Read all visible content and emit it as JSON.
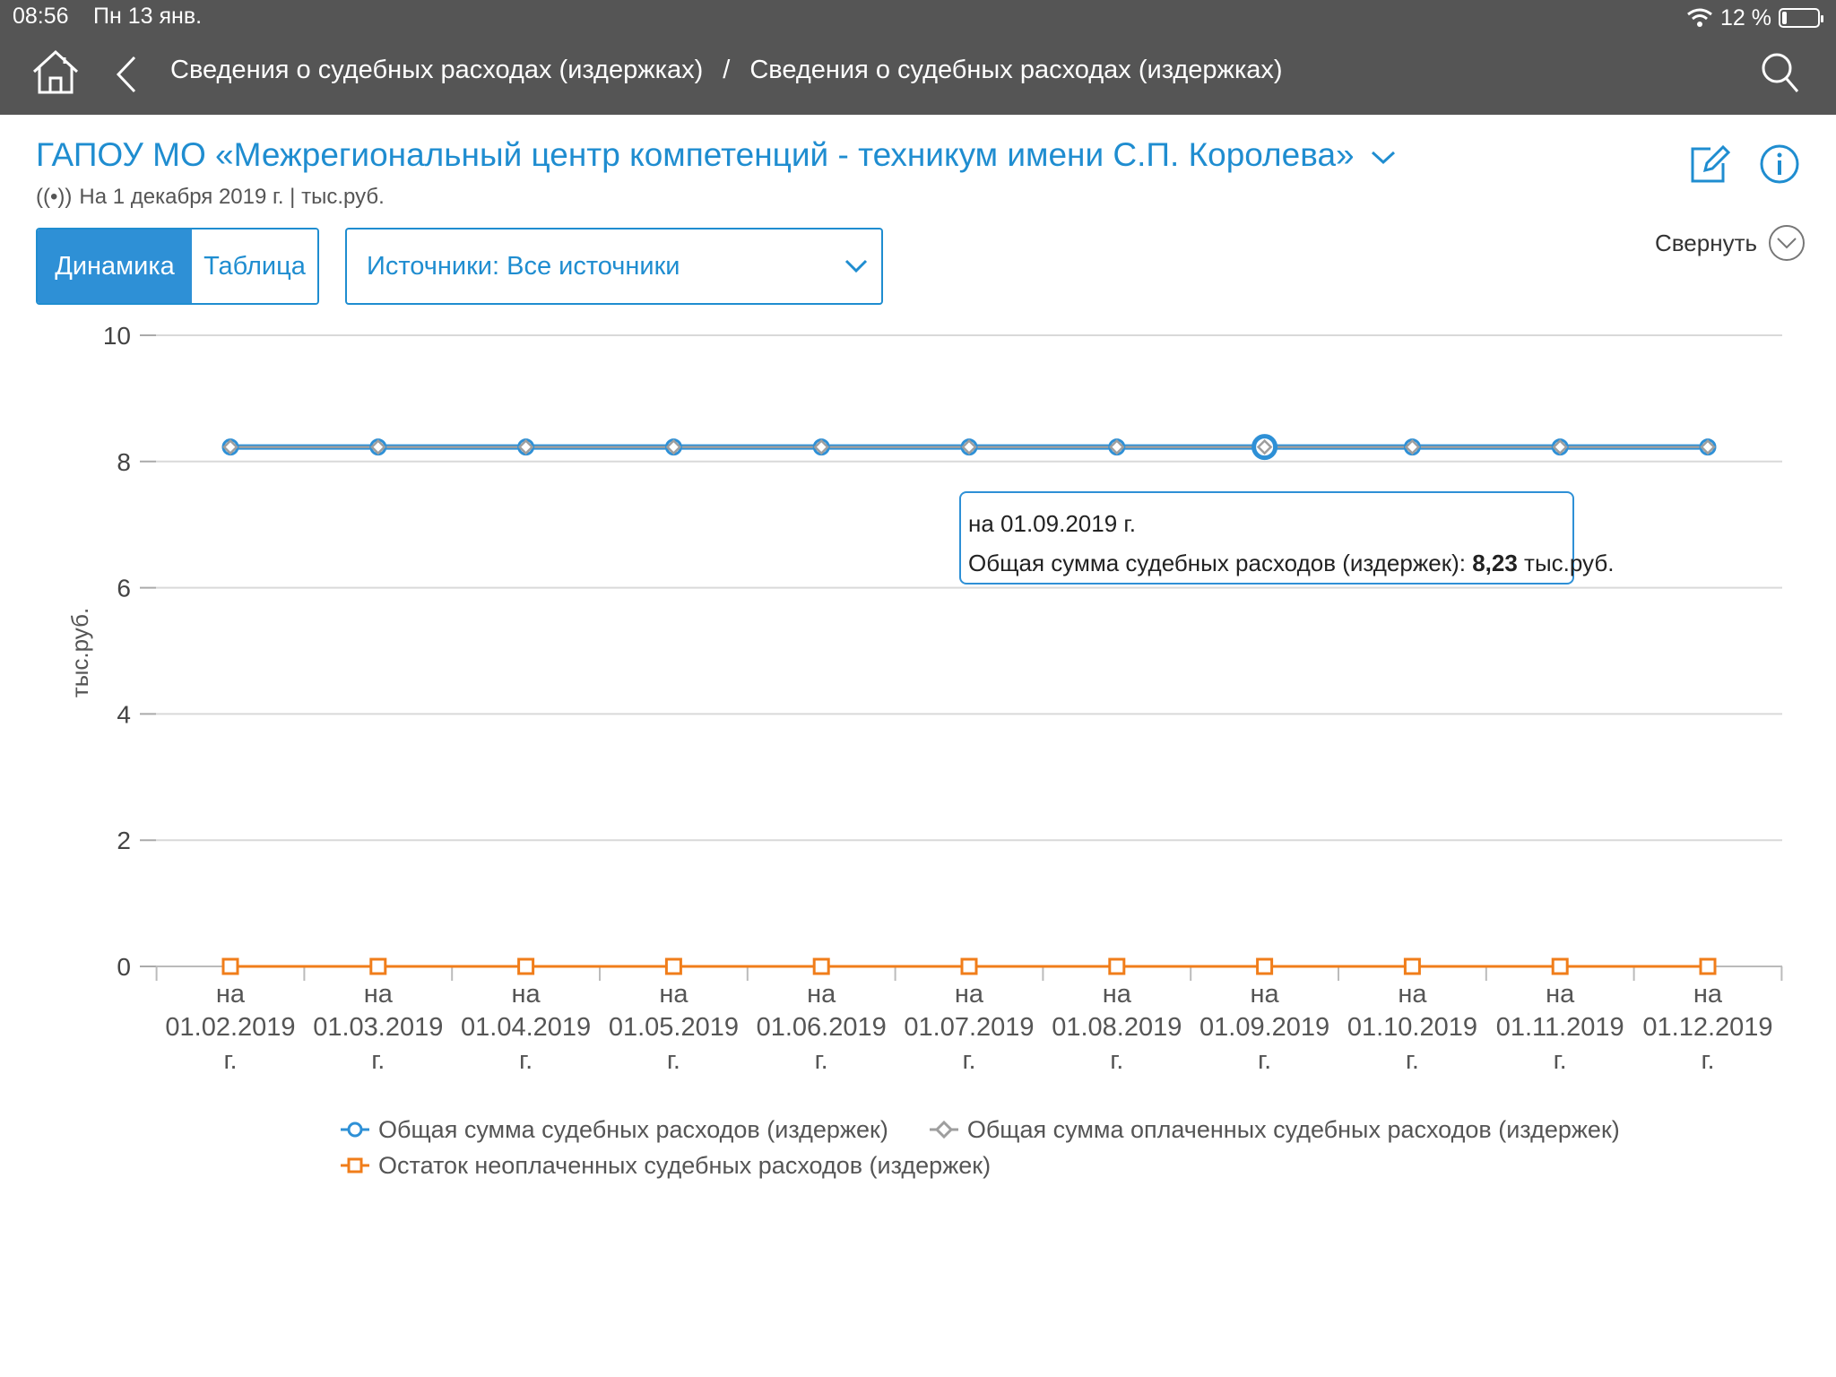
{
  "status_bar": {
    "time": "08:56",
    "date": "Пн 13 янв.",
    "battery": "12 %",
    "battery_level": 0.12
  },
  "nav": {
    "breadcrumb": [
      "Сведения о судебных расходах (издержках)",
      "Сведения о судебных расходах (издержках)"
    ],
    "separator": "/"
  },
  "header": {
    "org_title": "ГАПОУ МО «Межрегиональный центр компетенций - техникум имени С.П. Королева»",
    "live_icon": "((•))",
    "subtitle": "На 1 декабря 2019 г. | тыс.руб."
  },
  "controls": {
    "tab_dynamics": "Динамика",
    "tab_table": "Таблица",
    "active_tab": "dynamics",
    "sources_label": "Источники: Все источники",
    "collapse_label": "Свернуть"
  },
  "colors": {
    "accent": "#1f8dd0",
    "total_series": "#2e90d6",
    "paid_series": "#9e9e9e",
    "unpaid_series": "#f07d1a",
    "topbar": "#555555"
  },
  "tooltip": {
    "date_line": "на 01.09.2019 г.",
    "series_label": "Общая сумма судебных расходов (издержек):",
    "value": "8,23",
    "unit": "тыс.руб."
  },
  "chart_data": {
    "type": "line",
    "ylabel": "тыс.руб.",
    "xlabel": "",
    "ylim": [
      0,
      10
    ],
    "yticks": [
      0,
      2,
      4,
      6,
      8,
      10
    ],
    "grid": true,
    "legend_position": "bottom",
    "categories": [
      [
        "на",
        "01.02.2019",
        "г."
      ],
      [
        "на",
        "01.03.2019",
        "г."
      ],
      [
        "на",
        "01.04.2019",
        "г."
      ],
      [
        "на",
        "01.05.2019",
        "г."
      ],
      [
        "на",
        "01.06.2019",
        "г."
      ],
      [
        "на",
        "01.07.2019",
        "г."
      ],
      [
        "на",
        "01.08.2019",
        "г."
      ],
      [
        "на",
        "01.09.2019",
        "г."
      ],
      [
        "на",
        "01.10.2019",
        "г."
      ],
      [
        "на",
        "01.11.2019",
        "г."
      ],
      [
        "на",
        "01.12.2019",
        "г."
      ]
    ],
    "highlighted_index": 7,
    "series": [
      {
        "name": "Общая сумма судебных расходов (издержек)",
        "marker": "circle",
        "color": "#2e90d6",
        "values": [
          8.23,
          8.23,
          8.23,
          8.23,
          8.23,
          8.23,
          8.23,
          8.23,
          8.23,
          8.23,
          8.23
        ]
      },
      {
        "name": "Общая сумма оплаченных судебных расходов (издержек)",
        "marker": "diamond",
        "color": "#9e9e9e",
        "values": [
          8.23,
          8.23,
          8.23,
          8.23,
          8.23,
          8.23,
          8.23,
          8.23,
          8.23,
          8.23,
          8.23
        ]
      },
      {
        "name": "Остаток неоплаченных судебных расходов (издержек)",
        "marker": "square",
        "color": "#f07d1a",
        "values": [
          0,
          0,
          0,
          0,
          0,
          0,
          0,
          0,
          0,
          0,
          0
        ]
      }
    ]
  }
}
